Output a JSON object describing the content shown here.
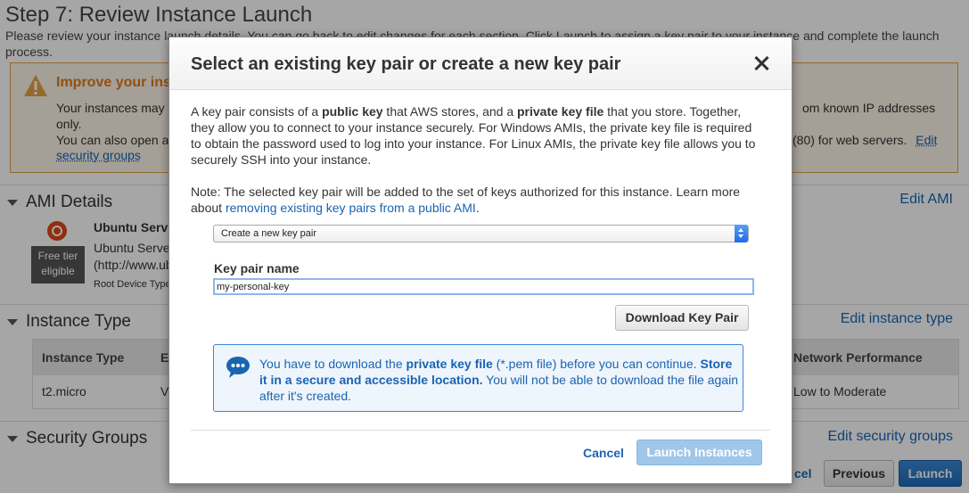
{
  "page": {
    "title": "Step 7: Review Instance Launch",
    "description": "Please review your instance launch details. You can go back to edit changes for each section. Click Launch to assign a key pair to your instance and complete the launch process.",
    "warning": {
      "title": "Improve your ins",
      "line1_left": "Your instances may only.",
      "line1_right": "om known IP addresses",
      "line2_left": "You can also open a",
      "line2_right": "(80) for web servers.",
      "edit_label": "Edit",
      "link": "security groups"
    },
    "sections": {
      "ami_details": "AMI Details",
      "edit_ami": "Edit AMI",
      "instance_type": "Instance Type",
      "edit_instance_type": "Edit instance type",
      "security_groups": "Security Groups",
      "edit_security_groups": "Edit security groups"
    },
    "ami": {
      "free_tier": "Free tier eligible",
      "name": "Ubuntu Serv",
      "desc_line1": "Ubuntu Server",
      "desc_line2": "(http://www.ub",
      "root_device": "Root Device Type"
    },
    "instance_table": {
      "col_instance_type": "Instance Type",
      "col_e": "E",
      "col_network": "Network Performance",
      "row_instance_type": "t2.micro",
      "row_v": "V",
      "row_network": "Low to Moderate"
    },
    "footer": {
      "cancel_peek": "cel",
      "previous": "Previous",
      "launch": "Launch"
    }
  },
  "modal": {
    "title": "Select an existing key pair or create a new key pair",
    "p1_a": "A key pair consists of a ",
    "p1_b": "public key",
    "p1_c": " that AWS stores, and a ",
    "p1_d": "private key file",
    "p1_e": " that you store. Together, they allow you to connect to your instance securely. For Windows AMIs, the private key file is required to obtain the password used to log into your instance. For Linux AMIs, the private key file allows you to securely SSH into your instance.",
    "p2_a": "Note: The selected key pair will be added to the set of keys authorized for this instance. Learn more about ",
    "p2_link": "removing existing key pairs from a public AMI",
    "p2_b": ".",
    "select_value": "Create a new key pair",
    "key_pair_label": "Key pair name",
    "key_pair_value": "my-personal-key",
    "download_button": "Download Key Pair",
    "info_a": "You have to download the ",
    "info_b": "private key file",
    "info_c": " (*.pem file) before you can continue. ",
    "info_d": "Store it in a secure and accessible location.",
    "info_e": " You will not be able to download the file again after it's created.",
    "cancel": "Cancel",
    "launch_instances": "Launch Instances"
  }
}
